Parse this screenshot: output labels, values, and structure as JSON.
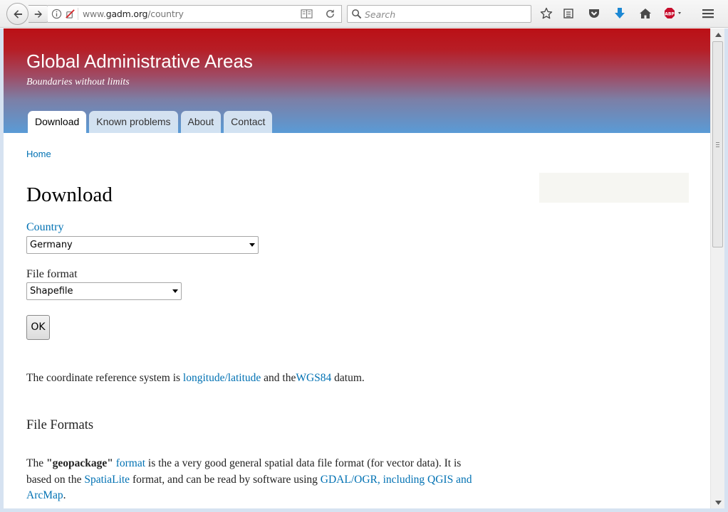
{
  "browser": {
    "url_prefix": "www.",
    "url_domain": "gadm.org",
    "url_path": "/country",
    "search_placeholder": "Search"
  },
  "site": {
    "title": "Global Administrative Areas",
    "slogan": "Boundaries without limits",
    "tabs": [
      {
        "label": "Download",
        "active": true
      },
      {
        "label": "Known problems",
        "active": false
      },
      {
        "label": "About",
        "active": false
      },
      {
        "label": "Contact",
        "active": false
      }
    ]
  },
  "breadcrumb": {
    "home": "Home"
  },
  "page": {
    "title": "Download",
    "country_label": "Country",
    "country_value": "Germany",
    "format_label": "File format",
    "format_value": "Shapefile",
    "ok_label": "OK"
  },
  "crs": {
    "t1": "The coordinate reference system is ",
    "link1": "longitude/latitude",
    "t2": " and the",
    "link2": "WGS84",
    "t3": " datum."
  },
  "formats": {
    "heading": "File Formats",
    "p_t1": "The ",
    "p_bold": "\"geopackage\"",
    "p_link1": "format",
    "p_t2": " is the a very good general spatial data file format (for vector data). It is",
    "p_t3": "based on the ",
    "p_link2": "SpatiaLite",
    "p_t4": " format, and can be read by software using ",
    "p_link3": "GDAL/OGR, including QGIS and",
    "p_link4": "ArcMap",
    "p_t5": "."
  },
  "colors": {
    "link": "#0071b3",
    "hero_top": "#bb1016",
    "hero_bottom": "#5a9bd6"
  }
}
